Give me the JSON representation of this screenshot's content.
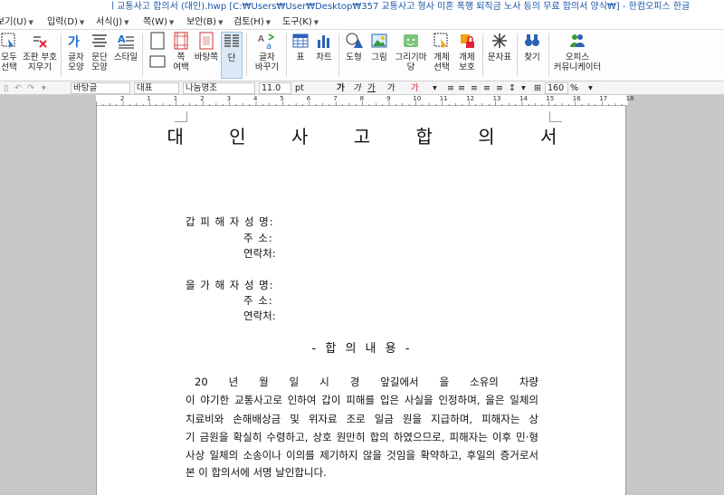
{
  "window": {
    "title": "ㅣ교통사고 합의서 (대인).hwp [C:₩Users₩User₩Desktop₩357 교통사고 형사 미혼 폭행 퇴직금 노사 등의 무료 합의서 양식₩] - 한컴오피스 한글"
  },
  "menu": [
    {
      "label": "보기(U)"
    },
    {
      "label": "입력(D)"
    },
    {
      "label": "서식(J)"
    },
    {
      "label": "쪽(W)"
    },
    {
      "label": "보안(B)"
    },
    {
      "label": "검토(H)"
    },
    {
      "label": "도구(K)"
    }
  ],
  "ribbon": {
    "select_all": "모두\n선택",
    "clear_marks": "조판 부호\n지우기",
    "char_shape": "글자\n모양",
    "para_shape": "문단\n모양",
    "style": "스타일",
    "page_margin": "쪽\n여백",
    "background": "바탕쪽",
    "columns": "단",
    "char_replace": "글자\n바꾸기",
    "table": "표",
    "chart": "차트",
    "shape": "도형",
    "picture": "그림",
    "draw_market": "그리기마당",
    "object_select": "개체\n선택",
    "object_protect": "개체\n보호",
    "symbol": "문자표",
    "find": "찾기",
    "office_comm": "오피스\n커뮤니케이터"
  },
  "formatbar": {
    "style_value": "바탕글",
    "lang_value": "대표",
    "font_value": "나눔명조",
    "size_value": "11.0",
    "size_unit": "pt",
    "zoom_value": "160",
    "zoom_unit": "%"
  },
  "ruler": {
    "numbers": [
      "2",
      "1",
      "1",
      "2",
      "3",
      "4",
      "5",
      "6",
      "7",
      "8",
      "9",
      "10",
      "11",
      "12",
      "13",
      "14",
      "15",
      "16",
      "17",
      "18"
    ]
  },
  "document": {
    "title": "대 인 사 고 합 의 서",
    "party_a": {
      "name_label": "갑 피 해 자 성  명:",
      "addr_label": "주  소:",
      "contact_label": "연락처:"
    },
    "party_b": {
      "name_label": "을 가 해 자 성  명:",
      "addr_label": "주  소:",
      "contact_label": "연락처:"
    },
    "section_heading": "- 합 의 내 용 -",
    "body_lines": [
      "20   년    월    일   시  경                  앞길에서 을 소유의                 차량",
      "이 야기한 교통사고로 인하여 갑이 피해를 입은 사실을 인정하며, 을은 일체의",
      "치료비와 손해배상금 및 위자료 조로 일금             원을 지급하며, 피해자는 상",
      "기 금원을 확실히 수령하고, 상호 원만히 합의 하였으므로, 피해자는 이후 민·형",
      "사상 일체의 소송이나 이의를 제기하지 않을 것임을 확약하고, 후일의 증거로서",
      "본 이 합의서에 서명 날인합니다."
    ]
  },
  "colors": {
    "title_text": "#1a56a8",
    "accent": "#dbe8f6"
  }
}
